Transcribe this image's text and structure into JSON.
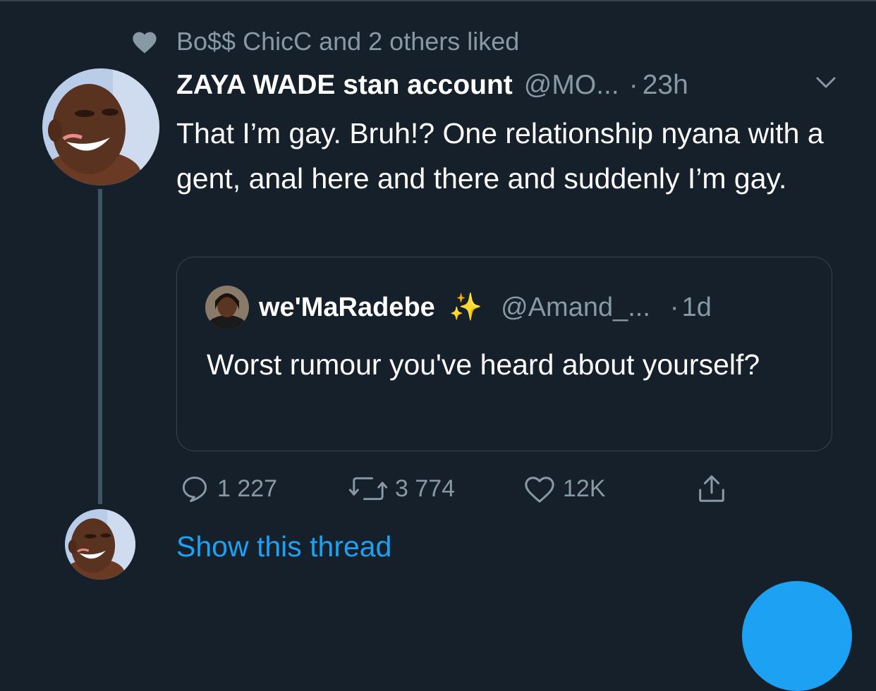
{
  "social_context": {
    "text": "Bo$$ ChicC and 2 others liked",
    "icon": "heart-icon"
  },
  "tweet": {
    "author_name": "ZAYA WADE stan account",
    "author_handle": "@MO...",
    "separator": "·",
    "time": "23h",
    "text": "That I’m gay. Bruh!? One relationship nyana with a gent, anal here and there and suddenly I’m gay."
  },
  "quote": {
    "author_name": "we'MaRadebe",
    "emoji": "✨",
    "author_handle": "@Amand_...",
    "separator": "·",
    "time": "1d",
    "text": "Worst rumour you've heard about yourself?"
  },
  "actions": {
    "reply_count": "1 227",
    "retweet_count": "3 774",
    "like_count": "12K"
  },
  "show_thread_label": "Show this thread",
  "colors": {
    "background": "#15202b",
    "secondary_text": "#8899a6",
    "accent": "#1da1f2",
    "border": "#38444d"
  }
}
